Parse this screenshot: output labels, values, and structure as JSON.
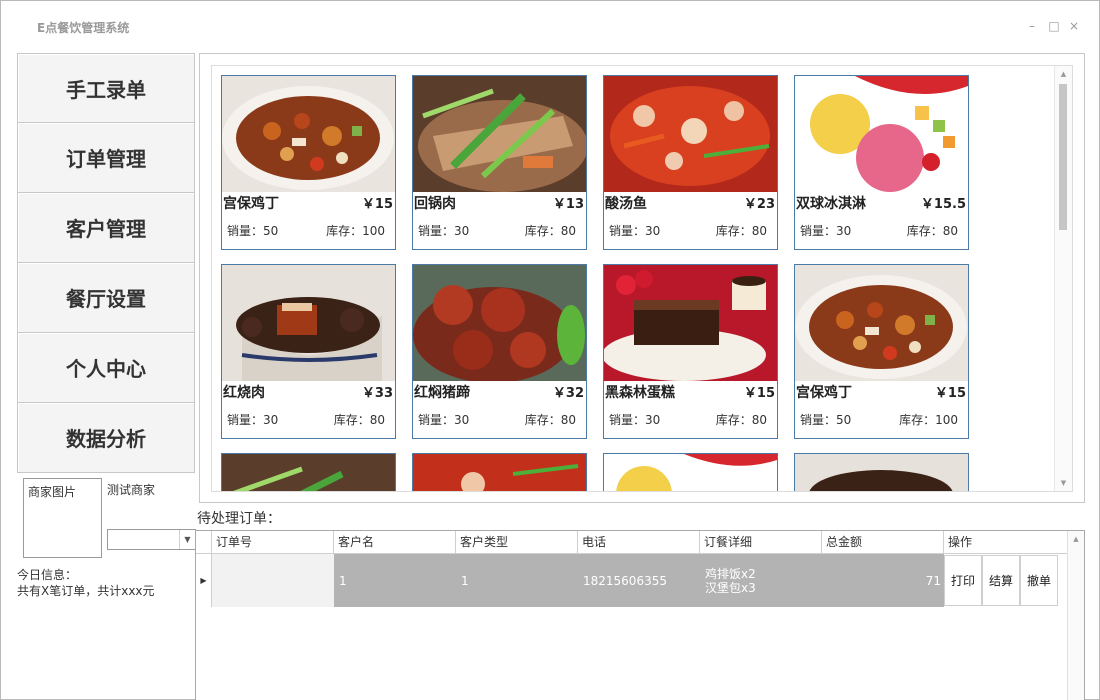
{
  "window": {
    "title": "E点餐饮管理系统",
    "controls": {
      "minimize": "–",
      "maximize": "□",
      "close": "×"
    }
  },
  "nav": {
    "items": [
      {
        "label": "手工录单"
      },
      {
        "label": "订单管理"
      },
      {
        "label": "客户管理"
      },
      {
        "label": "餐厅设置"
      },
      {
        "label": "个人中心"
      },
      {
        "label": "数据分析"
      }
    ]
  },
  "merchant": {
    "image_label": "商家图片",
    "name": "测试商家"
  },
  "today": {
    "title": "今日信息：",
    "summary": "共有X笔订单，共计xxx元"
  },
  "menu": {
    "items": [
      {
        "name": "宫保鸡丁",
        "price": "￥15",
        "sales": "销量：50",
        "stock": "库存：100"
      },
      {
        "name": "回锅肉",
        "price": "￥13",
        "sales": "销量：30",
        "stock": "库存：80"
      },
      {
        "name": "酸汤鱼",
        "price": "￥23",
        "sales": "销量：30",
        "stock": "库存：80"
      },
      {
        "name": "双球冰淇淋",
        "price": "￥15.5",
        "sales": "销量：30",
        "stock": "库存：80"
      },
      {
        "name": "红烧肉",
        "price": "￥33",
        "sales": "销量：30",
        "stock": "库存：80"
      },
      {
        "name": "红焖猪蹄",
        "price": "￥32",
        "sales": "销量：30",
        "stock": "库存：80"
      },
      {
        "name": "黑森林蛋糕",
        "price": "￥15",
        "sales": "销量：30",
        "stock": "库存：80"
      },
      {
        "name": "宫保鸡丁",
        "price": "￥15",
        "sales": "销量：50",
        "stock": "库存：100"
      }
    ]
  },
  "orders": {
    "label": "待处理订单：",
    "columns": [
      "订单号",
      "客户名",
      "客户类型",
      "电话",
      "订餐详细",
      "总金额",
      "操作"
    ],
    "rows": [
      {
        "order_no": "",
        "customer": "1",
        "customer_type": "1",
        "phone": "18215606355",
        "detail_1": "鸡排饭x2",
        "detail_2": "汉堡包x3",
        "total": "71",
        "actions": [
          "打印",
          "结算",
          "撤单"
        ]
      }
    ]
  },
  "colors": {
    "card_border": "#4b7aa7",
    "selected_row": "#b3b3b3"
  }
}
